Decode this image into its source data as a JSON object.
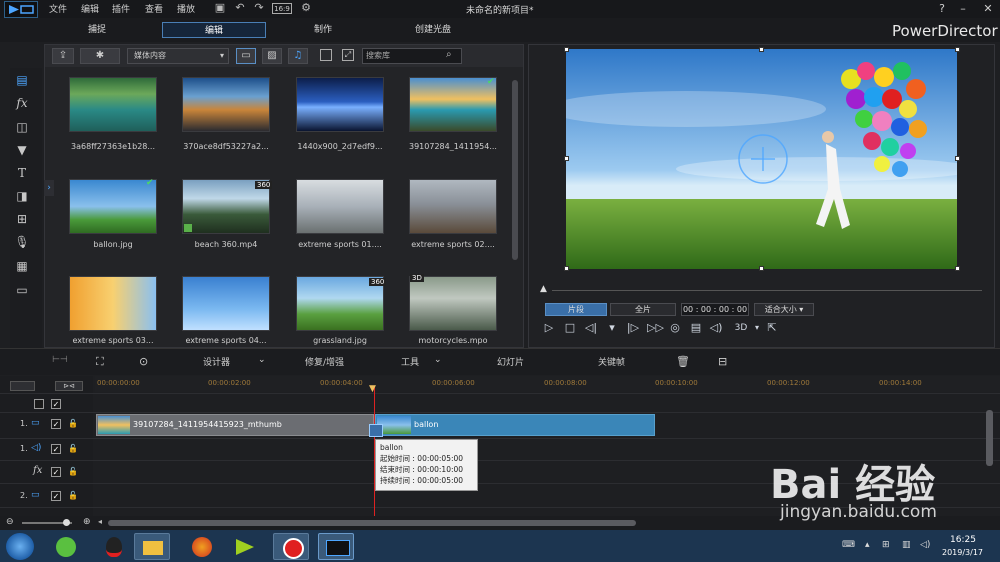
{
  "window": {
    "title": "未命名的新项目*",
    "menus": [
      "文件",
      "编辑",
      "插件",
      "查看",
      "播放"
    ],
    "zoom_indicator": "16:9",
    "help": "?"
  },
  "modes": {
    "tabs": [
      "捕捉",
      "编辑",
      "制作",
      "创建光盘"
    ],
    "active": "编辑",
    "brand": "PowerDirector"
  },
  "library": {
    "dropdown": "媒体内容",
    "search_placeholder": "搜索库",
    "items": [
      {
        "label": "3a68ff27363e1b28...",
        "badge": ""
      },
      {
        "label": "370ace8df53227a2...",
        "badge": ""
      },
      {
        "label": "1440x900_2d7edf9...",
        "badge": ""
      },
      {
        "label": "39107284_1411954...",
        "badge": ""
      },
      {
        "label": "ballon.jpg",
        "badge": ""
      },
      {
        "label": "beach 360.mp4",
        "badge": "360"
      },
      {
        "label": "extreme sports 01....",
        "badge": ""
      },
      {
        "label": "extreme sports 02....",
        "badge": ""
      },
      {
        "label": "extreme sports 03...",
        "badge": ""
      },
      {
        "label": "extreme sports 04...",
        "badge": ""
      },
      {
        "label": "grassland.jpg",
        "badge": "360"
      },
      {
        "label": "motorcycles.mpo",
        "badge": "3D"
      }
    ]
  },
  "preview": {
    "seg_clip": "片段",
    "seg_movie": "全片",
    "timecode": "00 : 00 : 00 : 00",
    "fit": "适合大小",
    "mode3d": "3D"
  },
  "timeline": {
    "toolbar": [
      "设计器",
      "修复/增强",
      "工具",
      "幻灯片",
      "关键帧"
    ],
    "ruler": [
      "00:00:00:00",
      "00:00:02:00",
      "00:00:04:00",
      "00:00:06:00",
      "00:00:08:00",
      "00:00:10:00",
      "00:00:12:00",
      "00:00:14:00"
    ],
    "tracks": [
      "1.",
      "1.",
      "2."
    ],
    "clips": [
      {
        "name": "39107284_1411954415923_mthumb"
      },
      {
        "name": "ballon"
      }
    ],
    "tooltip": {
      "name": "ballon",
      "start": "起始时间 : 00:00:05:00",
      "end": "结束时间 : 00:00:10:00",
      "duration": "持续时间 : 00:00:05:00"
    }
  },
  "taskbar": {
    "time": "16:25",
    "date": "2019/3/17"
  },
  "watermark": {
    "main": "Bai 经验",
    "sub": "jingyan.baidu.com"
  },
  "colors": {
    "accent": "#4a7fb5",
    "clip_video": "#3a86b8",
    "playhead": "#dd2222"
  }
}
